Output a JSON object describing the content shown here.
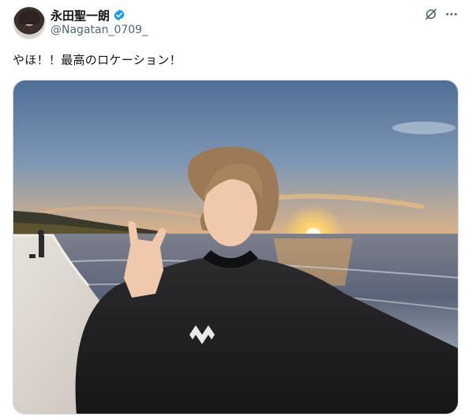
{
  "author": {
    "display_name": "永田聖一朗",
    "handle": "@Nagatan_0709_",
    "verified": true,
    "avatar_icon": "profile-avatar"
  },
  "header_actions": {
    "grok_icon": "grok-icon",
    "more_icon": "more-options-icon"
  },
  "tweet": {
    "text": "やほ！！最高のロケーション！"
  },
  "media": {
    "type": "photo",
    "icon": "sunset-beach-selfie-photo"
  },
  "colors": {
    "verified_blue": "#1d9bf0",
    "handle_gray": "#536471",
    "text": "#0f1419"
  }
}
